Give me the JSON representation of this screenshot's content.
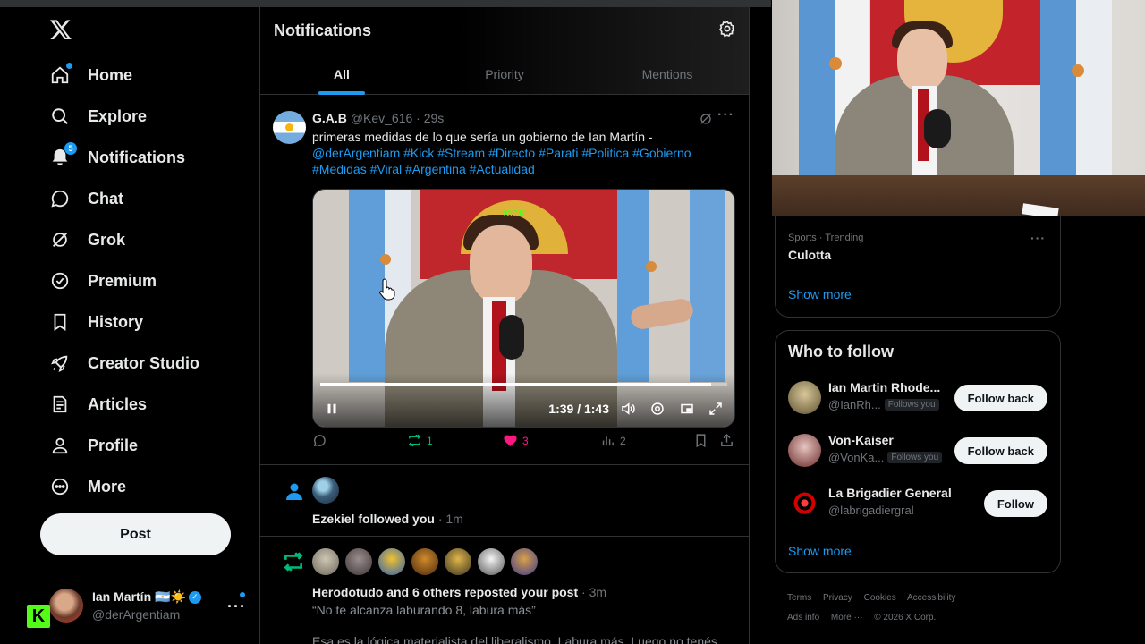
{
  "sidebar": {
    "nav": [
      {
        "label": "Home",
        "icon": "home-icon"
      },
      {
        "label": "Explore",
        "icon": "search-icon"
      },
      {
        "label": "Notifications",
        "icon": "bell-icon",
        "badge": "5"
      },
      {
        "label": "Chat",
        "icon": "chat-bubble-icon"
      },
      {
        "label": "Grok",
        "icon": "grok-icon"
      },
      {
        "label": "Premium",
        "icon": "verified-badge-icon"
      },
      {
        "label": "History",
        "icon": "bookmark-icon"
      },
      {
        "label": "Creator Studio",
        "icon": "rocket-icon"
      },
      {
        "label": "Articles",
        "icon": "article-icon"
      },
      {
        "label": "Profile",
        "icon": "person-icon"
      },
      {
        "label": "More",
        "icon": "more-circle-icon"
      }
    ],
    "post_label": "Post",
    "account": {
      "name": "Ian Martín 🇦🇷☀️",
      "handle": "@derArgentiam",
      "kick_logo": "K"
    }
  },
  "main": {
    "title": "Notifications",
    "tabs": [
      {
        "label": "All",
        "active": true
      },
      {
        "label": "Priority",
        "active": false
      },
      {
        "label": "Mentions",
        "active": false
      }
    ],
    "post": {
      "author": "G.A.B",
      "handle": "@Kev_616",
      "time": "29s",
      "text": "primeras medidas de lo que sería un gobierno de Ian Martín -",
      "tags": "@derArgentiam #Kick #Stream #Directo #Parati #Politica #Gobierno #Medidas #Viral #Argentina #Actualidad",
      "video": {
        "time": "1:39 / 1:43",
        "progress": 0.96,
        "watermark": "KICK"
      },
      "actions": {
        "replies": "",
        "reposts": "1",
        "likes": "3",
        "views": "2"
      }
    },
    "follow_notif": {
      "name": "Ezekiel",
      "action": " followed you",
      "time": " · 1m"
    },
    "repost_notif": {
      "names": "Herodotudo and 6 others reposted your post",
      "time": " · 3m",
      "quote": "“No te alcanza laburando 8, labura más”",
      "body": "Esa es la lógica materialista del liberalismo. Labura más. Luego no tenés"
    }
  },
  "right": {
    "trend": {
      "category": "Sports · Trending",
      "name": "Culotta",
      "show_more": "Show more"
    },
    "who_to_follow": {
      "title": "Who to follow",
      "users": [
        {
          "name": "Ian Martin Rhode...",
          "handle": "@IanRh...",
          "follows_you": "Follows you",
          "button": "Follow back"
        },
        {
          "name": "Von-Kaiser",
          "handle": "@VonKa...",
          "follows_you": "Follows you",
          "button": "Follow back"
        },
        {
          "name": "La Brigadier General",
          "handle": "@labrigadiergral",
          "follows_you": "",
          "button": "Follow"
        }
      ],
      "show_more": "Show more"
    },
    "footer": {
      "links": [
        "Terms",
        "Privacy",
        "Cookies",
        "Accessibility",
        "Ads info",
        "More ···",
        "© 2026 X Corp."
      ]
    },
    "colors": {
      "accent": "#1d9bf0",
      "like": "#f91880",
      "repost": "#00ba7c"
    }
  }
}
